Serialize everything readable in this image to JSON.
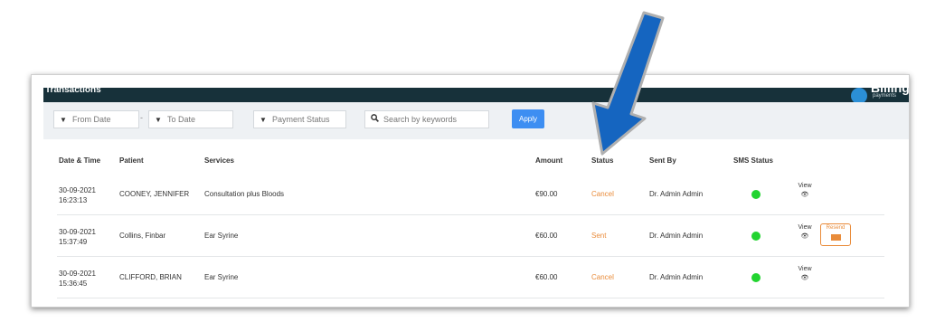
{
  "header": {
    "title": "Transactions",
    "logo_text": "Billing",
    "logo_sub": "payments"
  },
  "filters": {
    "from_date": "From Date",
    "to_date": "To Date",
    "separator": "-",
    "payment_status": "Payment Status",
    "search_placeholder": "Search by keywords",
    "apply_label": "Apply"
  },
  "columns": [
    "Date & Time",
    "Patient",
    "Services",
    "Amount",
    "Status",
    "Sent By",
    "SMS Status"
  ],
  "rows": [
    {
      "date": "30-09-2021",
      "time": "16:23:13",
      "patient": "COONEY, JENNIFER",
      "service": "Consultation plus Bloods",
      "amount": "€90.00",
      "status": "Cancel",
      "sent_by": "Dr. Admin Admin",
      "view": "View"
    },
    {
      "date": "30-09-2021",
      "time": "15:37:49",
      "patient": "Collins, Finbar",
      "service": "Ear Syrine",
      "amount": "€60.00",
      "status": "Sent",
      "sent_by": "Dr. Admin Admin",
      "view": "View",
      "resend": "Resend"
    },
    {
      "date": "30-09-2021",
      "time": "15:36:45",
      "patient": "CLIFFORD, BRIAN",
      "service": "Ear Syrine",
      "amount": "€60.00",
      "status": "Cancel",
      "sent_by": "Dr. Admin Admin",
      "view": "View"
    }
  ],
  "colors": {
    "header_bg": "#17313a",
    "status_orange": "#e98c3b",
    "sms_green": "#22d430",
    "apply_blue": "#3d8ef2",
    "arrow_blue": "#1565c0"
  }
}
